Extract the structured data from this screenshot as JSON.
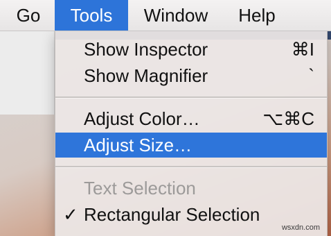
{
  "menubar": {
    "items": [
      {
        "label": "Go"
      },
      {
        "label": "Tools"
      },
      {
        "label": "Window"
      },
      {
        "label": "Help"
      }
    ],
    "active": "Tools"
  },
  "tools_menu": {
    "items": [
      {
        "label": "Show Inspector",
        "shortcut": "⌘I",
        "state": "normal"
      },
      {
        "label": "Show Magnifier",
        "shortcut": "`",
        "state": "normal"
      },
      {
        "label": "Adjust Color…",
        "shortcut": "⌥⌘C",
        "state": "normal"
      },
      {
        "label": "Adjust Size…",
        "shortcut": "",
        "state": "highlighted"
      },
      {
        "label": "Text Selection",
        "shortcut": "",
        "state": "disabled"
      },
      {
        "label": "Rectangular Selection",
        "shortcut": "",
        "state": "checked",
        "check": "✓"
      }
    ]
  },
  "watermark": "wsxdn.com",
  "colors": {
    "accent": "#2e75da",
    "disabled_text": "#9c9a99"
  }
}
